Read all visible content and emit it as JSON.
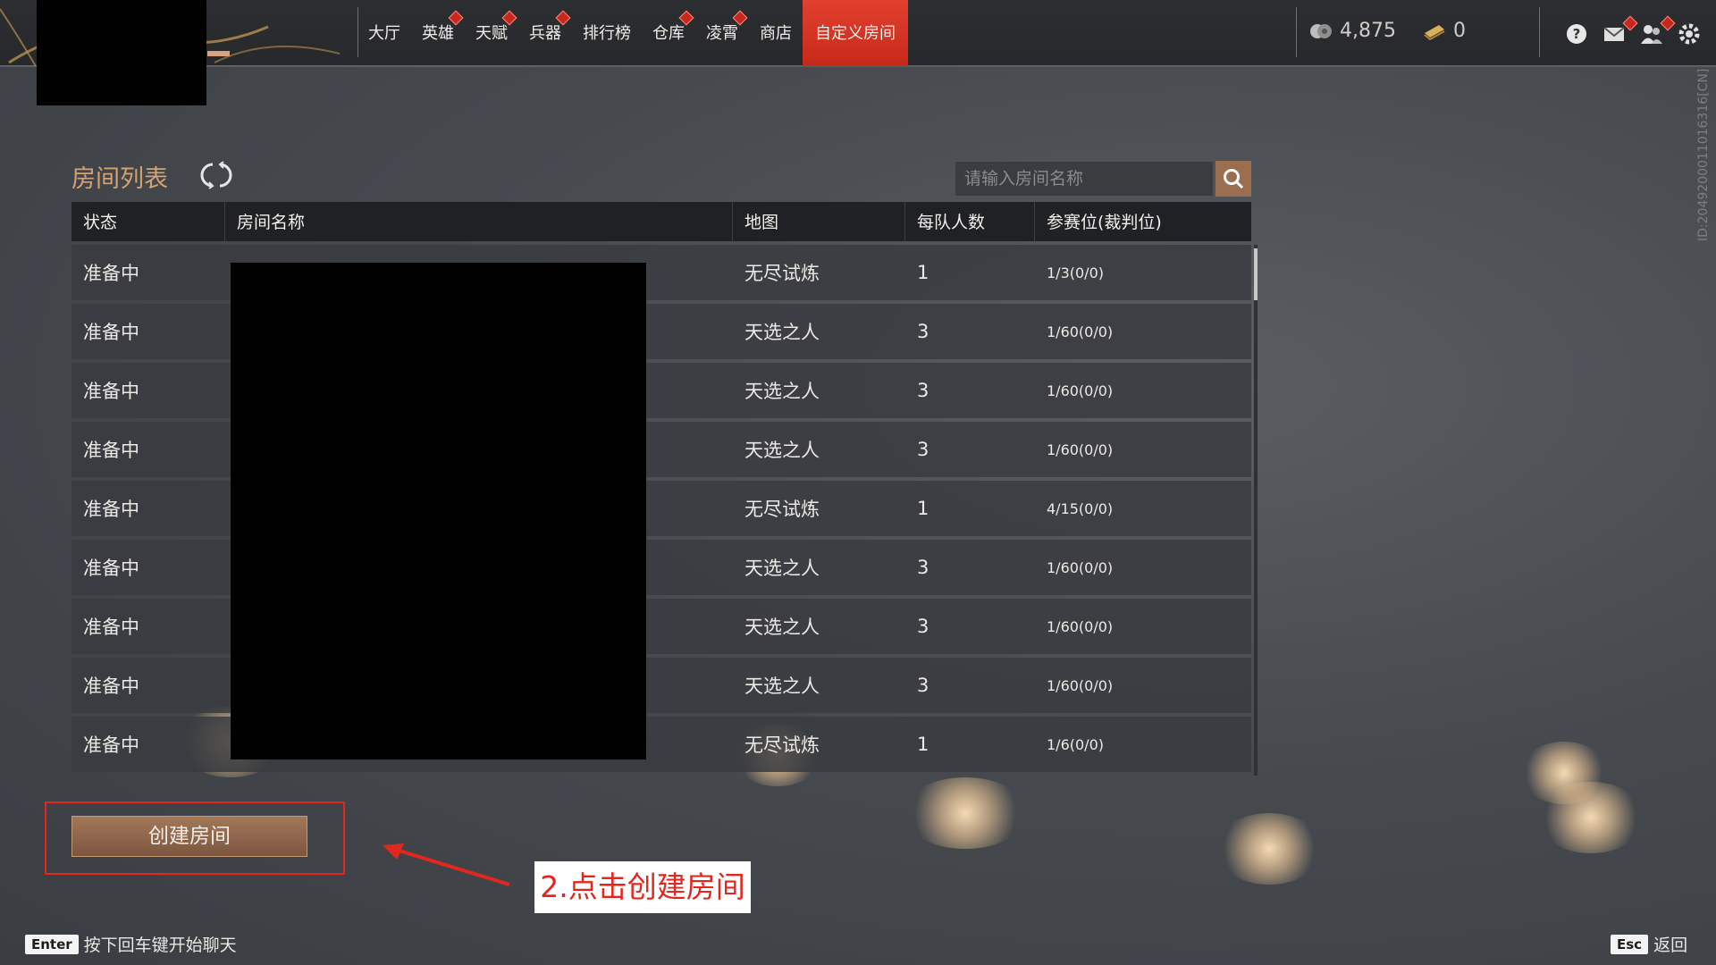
{
  "nav": {
    "items": [
      {
        "label": "大厅",
        "dot": false
      },
      {
        "label": "英雄",
        "dot": true
      },
      {
        "label": "天赋",
        "dot": true
      },
      {
        "label": "兵器",
        "dot": true
      },
      {
        "label": "排行榜",
        "dot": false
      },
      {
        "label": "仓库",
        "dot": true
      },
      {
        "label": "凌霄",
        "dot": true
      },
      {
        "label": "商店",
        "dot": false
      },
      {
        "label": "自定义房间",
        "dot": false,
        "active": true
      }
    ]
  },
  "currency": {
    "coins": "4,875",
    "tickets": "0"
  },
  "colors": {
    "accent": "#d6a36e",
    "active_tab": "#e2402e",
    "alert": "#e2281e"
  },
  "room_list": {
    "title": "房间列表",
    "search_placeholder": "请输入房间名称",
    "columns": [
      "状态",
      "房间名称",
      "地图",
      "每队人数",
      "参赛位(裁判位)"
    ],
    "rows": [
      {
        "status": "准备中",
        "name": "",
        "map": "无尽试炼",
        "per_team": "1",
        "slots": "1/3(0/0)"
      },
      {
        "status": "准备中",
        "name": "",
        "map": "天选之人",
        "per_team": "3",
        "slots": "1/60(0/0)"
      },
      {
        "status": "准备中",
        "name": "",
        "map": "天选之人",
        "per_team": "3",
        "slots": "1/60(0/0)"
      },
      {
        "status": "准备中",
        "name": "",
        "map": "天选之人",
        "per_team": "3",
        "slots": "1/60(0/0)"
      },
      {
        "status": "准备中",
        "name": "",
        "map": "无尽试炼",
        "per_team": "1",
        "slots": "4/15(0/0)"
      },
      {
        "status": "准备中",
        "name": "",
        "map": "天选之人",
        "per_team": "3",
        "slots": "1/60(0/0)"
      },
      {
        "status": "准备中",
        "name": "",
        "map": "天选之人",
        "per_team": "3",
        "slots": "1/60(0/0)"
      },
      {
        "status": "准备中",
        "name": "",
        "map": "天选之人",
        "per_team": "3",
        "slots": "1/60(0/0)"
      },
      {
        "status": "准备中",
        "name": "",
        "map": "无尽试炼",
        "per_team": "1",
        "slots": "1/6(0/0)"
      }
    ]
  },
  "create_button_label": "创建房间",
  "annotation": "2.点击创建房间",
  "side_id": "ID:2049200011016316[CN]",
  "chat_hint": {
    "key": "Enter",
    "text": "按下回车键开始聊天"
  },
  "back_hint": {
    "key": "Esc",
    "text": "返回"
  }
}
